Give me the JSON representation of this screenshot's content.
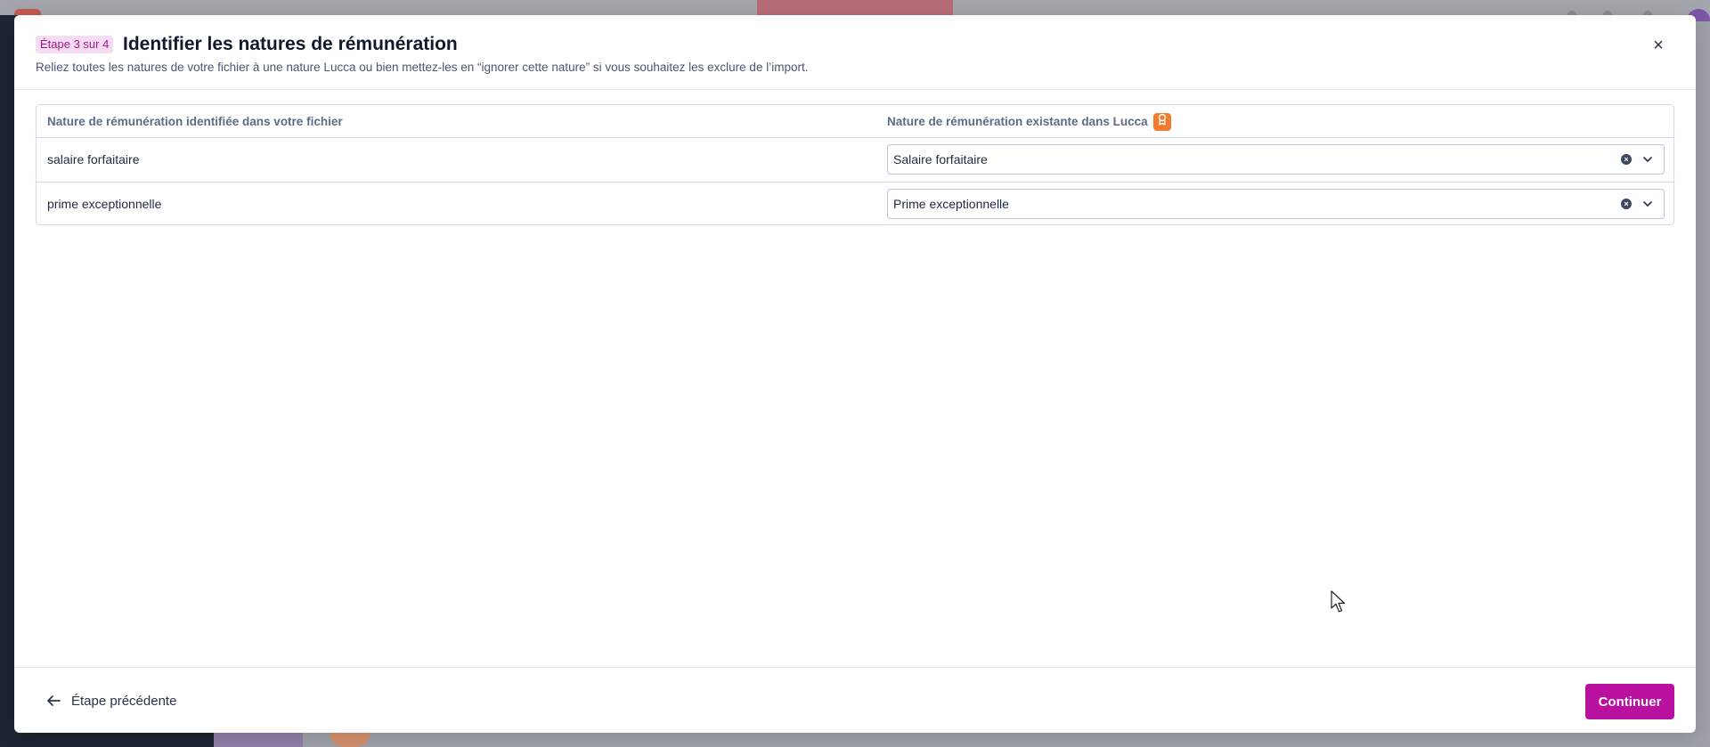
{
  "modal": {
    "step_badge": "Étape 3 sur 4",
    "title": "Identifier les natures de rémunération",
    "subtitle": "Reliez toutes les natures de votre fichier à une nature Lucca ou bien mettez-les en “ignorer cette nature” si vous souhaitez les exclure de l’import.",
    "close_icon": "close-icon",
    "close_glyph": "×"
  },
  "table": {
    "headers": {
      "left": "Nature de rémunération identifiée dans votre fichier",
      "right": "Nature de rémunération existante dans Lucca"
    },
    "pro_badge_icon": "medal-icon",
    "pro_badge_color": "#f27b2e",
    "rows": [
      {
        "file_nature": "salaire forfaitaire",
        "lucca_nature": "Salaire forfaitaire"
      },
      {
        "file_nature": "prime exceptionnelle",
        "lucca_nature": "Prime exceptionnelle"
      }
    ]
  },
  "footer": {
    "prev_label": "Étape précédente",
    "continue_label": "Continuer",
    "accent_color": "#b9109f"
  }
}
